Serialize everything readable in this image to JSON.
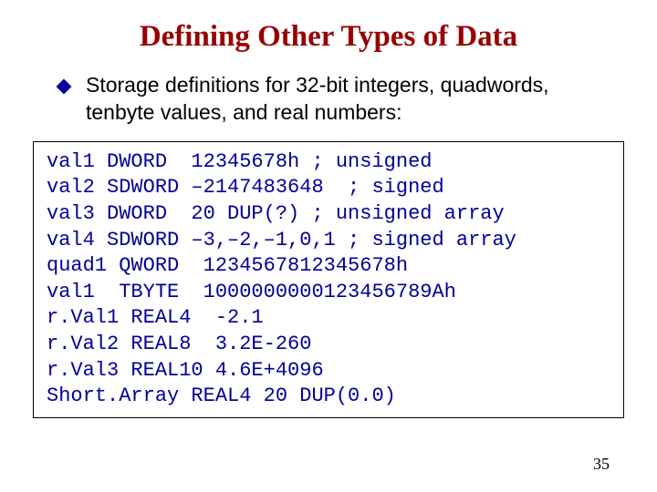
{
  "title": "Defining Other Types of Data",
  "bullet": "Storage definitions for 32-bit integers, quadwords, tenbyte values, and real numbers:",
  "code": {
    "l0": "val1 DWORD  12345678h ; unsigned",
    "l1": "val2 SDWORD –2147483648  ; signed",
    "l2": "val3 DWORD  20 DUP(?) ; unsigned array",
    "l3": "val4 SDWORD –3,–2,–1,0,1 ; signed array",
    "l4": "quad1 QWORD  1234567812345678h",
    "l5": "val1  TBYTE  1000000000123456789Ah",
    "l6": "r.Val1 REAL4  -2.1",
    "l7": "r.Val2 REAL8  3.2E-260",
    "l8": "r.Val3 REAL10 4.6E+4096",
    "l9": "Short.Array REAL4 20 DUP(0.0)"
  },
  "page_number": "35"
}
